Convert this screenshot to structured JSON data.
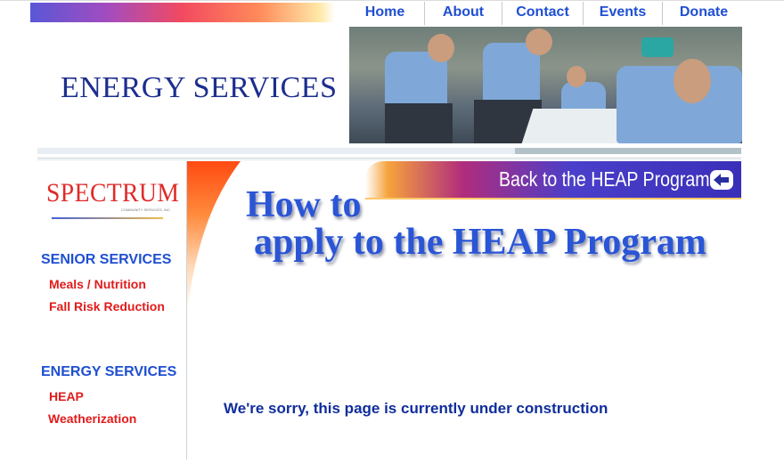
{
  "nav": {
    "items": [
      "Home",
      "About",
      "Contact",
      "Events",
      "Donate"
    ]
  },
  "header": {
    "title": "ENERGY SERVICES",
    "photo_icon": "workers-photo"
  },
  "sidebar": {
    "logo_text": "SPECTRUM",
    "logo_subtext": "COMMUNITY SERVICES, INC.",
    "sections": [
      {
        "heading": "SENIOR SERVICES",
        "links": [
          "Meals / Nutrition",
          "Fall Risk Reduction"
        ]
      },
      {
        "heading": "ENERGY SERVICES",
        "links": [
          "HEAP",
          "Weatherization"
        ]
      }
    ]
  },
  "main": {
    "back_label": "Back to the HEAP Program",
    "back_icon": "arrow-left-icon",
    "heading_line1": "How to",
    "heading_line2": "apply to the HEAP Program",
    "notice": "We're sorry, this page is currently under construction"
  },
  "colors": {
    "nav_blue": "#1f4fd2",
    "title_navy": "#1c2e8e",
    "link_red": "#e21b1b",
    "notice_blue": "#102d9c"
  }
}
